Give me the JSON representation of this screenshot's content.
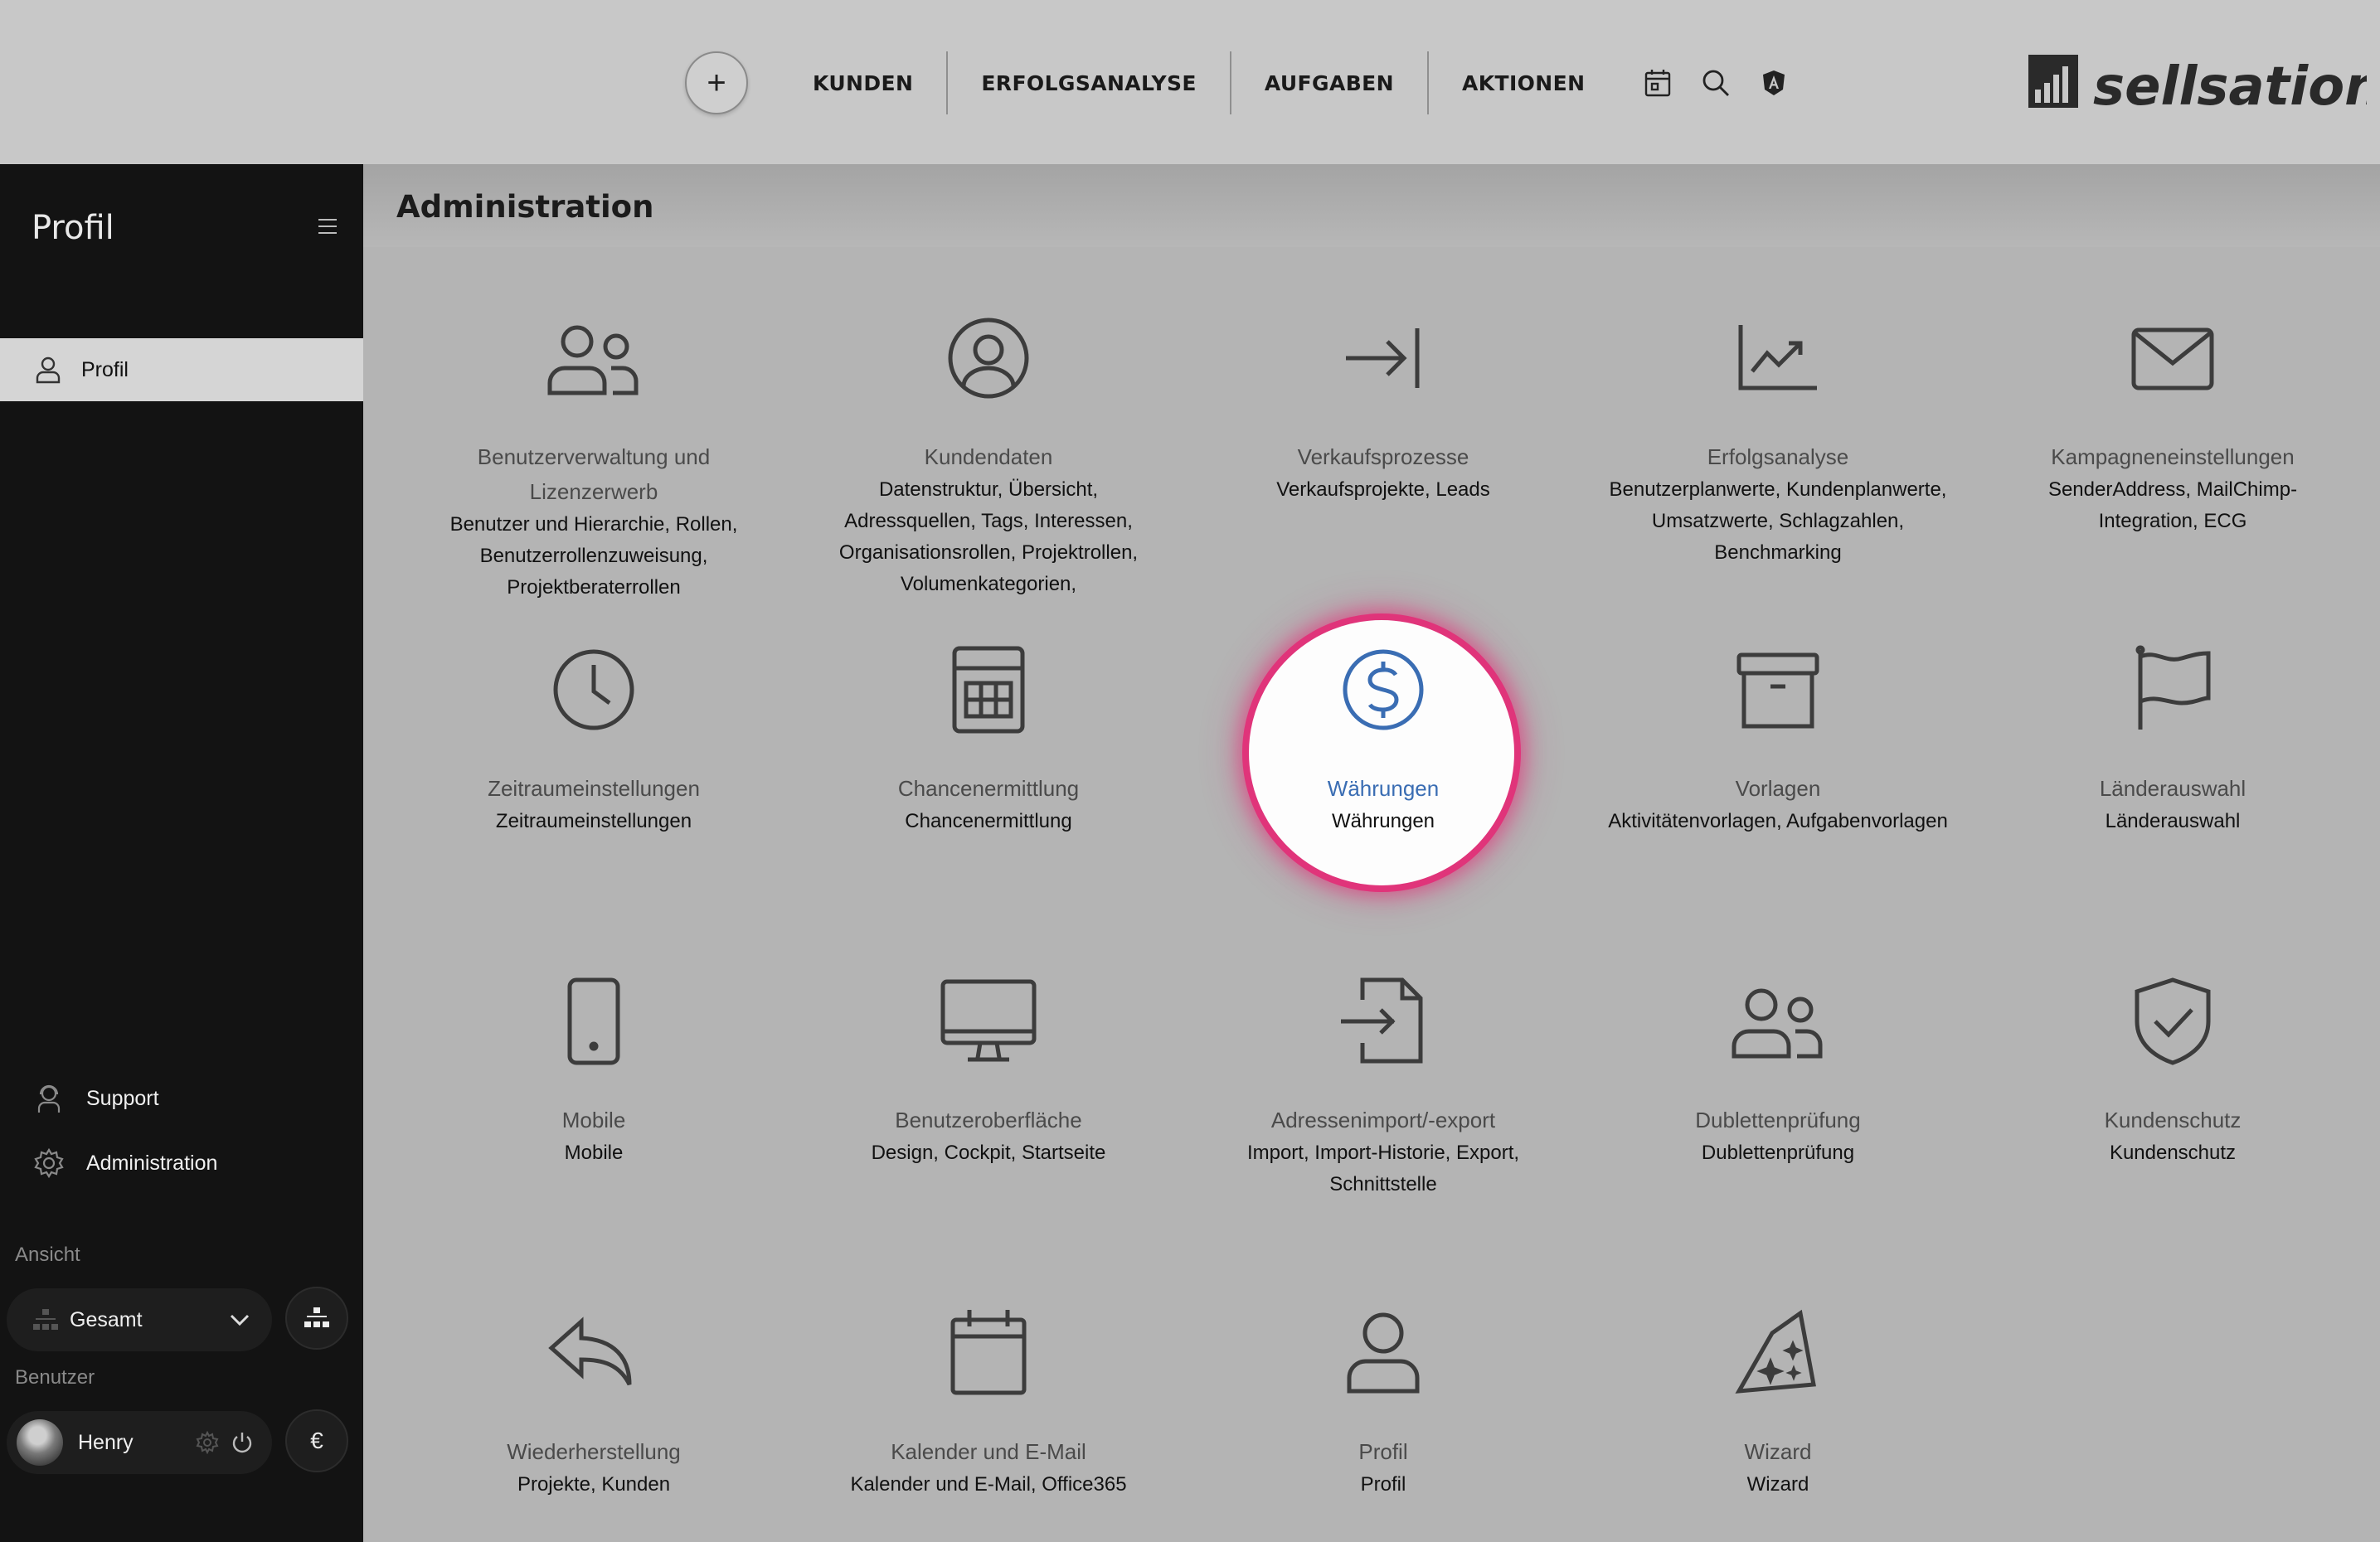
{
  "nav": {
    "add_label": "+",
    "items": [
      "KUNDEN",
      "ERFOLGSANALYSE",
      "AUFGABEN",
      "AKTIONEN"
    ]
  },
  "brand": {
    "logo_text": "sellsation"
  },
  "sidebar": {
    "title": "Profil",
    "active_item": "Profil",
    "links": [
      {
        "label": "Support"
      },
      {
        "label": "Administration"
      }
    ],
    "view_section": "Ansicht",
    "view_select": "Gesamt",
    "user_section": "Benutzer",
    "user_name": "Henry",
    "currency_button": "€"
  },
  "main": {
    "title": "Administration",
    "tiles": [
      {
        "name": "Benutzerverwaltung und Lizenzerwerb",
        "desc": "Benutzer und Hierarchie, Rollen, Benutzerrollenzuweisung, Projektberaterrollen",
        "icon": "users-icon"
      },
      {
        "name": "Kundendaten",
        "desc": "Datenstruktur, Übersicht, Adressquellen, Tags, Interessen, Organisationsrollen, Projektrollen, Volumenkategorien,",
        "icon": "user-circle-icon"
      },
      {
        "name": "Verkaufsprozesse",
        "desc": "Verkaufsprojekte, Leads",
        "icon": "arrow-right-bar-icon"
      },
      {
        "name": "Erfolgsanalyse",
        "desc": "Benutzerplanwerte, Kundenplanwerte, Umsatzwerte, Schlagzahlen, Benchmarking",
        "icon": "trend-chart-icon"
      },
      {
        "name": "Kampagneneinstellungen",
        "desc": "SenderAddress, MailChimp-Integration, ECG",
        "icon": "envelope-icon"
      },
      {
        "name": "Zeitraumeinstellungen",
        "desc": "Zeitraumeinstellungen",
        "icon": "clock-icon"
      },
      {
        "name": "Chancenermittlung",
        "desc": "Chancenermittlung",
        "icon": "calculator-icon"
      },
      {
        "name": "Währungen",
        "desc": "Währungen",
        "icon": "dollar-icon",
        "highlighted": true
      },
      {
        "name": "Vorlagen",
        "desc": "Aktivitätenvorlagen, Aufgabenvorlagen",
        "icon": "archive-box-icon"
      },
      {
        "name": "Länderauswahl",
        "desc": "Länderauswahl",
        "icon": "flag-icon"
      },
      {
        "name": "Mobile",
        "desc": "Mobile",
        "icon": "smartphone-icon"
      },
      {
        "name": "Benutzeroberfläche",
        "desc": "Design, Cockpit, Startseite",
        "icon": "monitor-icon"
      },
      {
        "name": "Adressenimport/-export",
        "desc": "Import, Import-Historie, Export, Schnittstelle",
        "icon": "file-import-icon"
      },
      {
        "name": "Dublettenprüfung",
        "desc": "Dublettenprüfung",
        "icon": "users-duplicate-icon"
      },
      {
        "name": "Kundenschutz",
        "desc": "Kundenschutz",
        "icon": "shield-check-icon"
      },
      {
        "name": "Wiederherstellung",
        "desc": "Projekte, Kunden",
        "icon": "undo-arrow-icon"
      },
      {
        "name": "Kalender und E-Mail",
        "desc": "Kalender und E-Mail, Office365",
        "icon": "calendar-icon"
      },
      {
        "name": "Profil",
        "desc": "Profil",
        "icon": "user-icon"
      },
      {
        "name": "Wizard",
        "desc": "Wizard",
        "icon": "wizard-hat-icon"
      }
    ]
  },
  "colors": {
    "accent_blue": "#3a6db3",
    "highlight_pink": "#e0347a",
    "sidebar_bg": "#131313",
    "main_bg": "#b4b4b4"
  }
}
